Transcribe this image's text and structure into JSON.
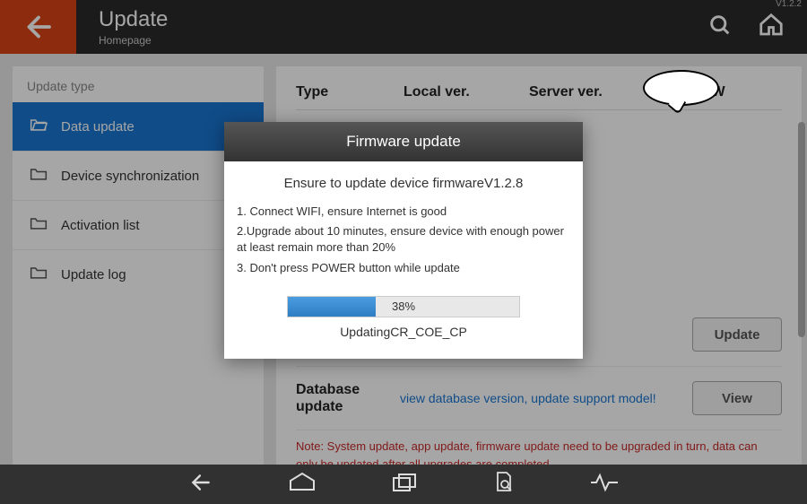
{
  "topbar": {
    "title": "Update",
    "subtitle": "Homepage",
    "version": "V1.2.2"
  },
  "sidebar": {
    "header": "Update type",
    "items": [
      {
        "label": "Data update",
        "active": true
      },
      {
        "label": "Device synchronization",
        "active": false
      },
      {
        "label": "Activation list",
        "active": false
      },
      {
        "label": "Update log",
        "active": false
      }
    ]
  },
  "table": {
    "headers": {
      "type": "Type",
      "local": "Local ver.",
      "server": "Server ver.",
      "what": "W"
    },
    "rows": [
      {
        "type": "Database update",
        "desc": "view database version, update support model!",
        "btn": "View"
      }
    ],
    "firmware_row_btn": "Update",
    "note": "Note: System update, app update, firmware update need to be upgraded in turn, data can only be updated after all upgrades are completed."
  },
  "modal": {
    "title": "Firmware update",
    "subtitle": "Ensure to update device firmwareV1.2.8",
    "steps": [
      "1. Connect WIFI, ensure Internet is good",
      "2.Upgrade about 10 minutes, ensure device with enough power at least remain more than 20%",
      "3. Don't press POWER button while update"
    ],
    "progress_percent": "38%",
    "progress_value": 38,
    "updating": "UpdatingCR_COE_CP"
  }
}
